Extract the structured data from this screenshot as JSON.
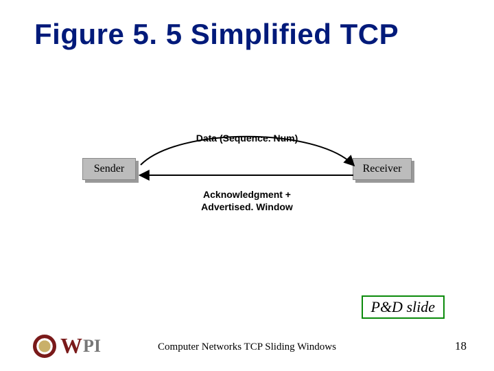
{
  "title": "Figure 5. 5 Simplified TCP",
  "diagram": {
    "sender_label": "Sender",
    "receiver_label": "Receiver",
    "top_arrow_label": "Data (Sequence. Num)",
    "bottom_arrow_label_line1": "Acknowledgment +",
    "bottom_arrow_label_line2": "Advertised. Window"
  },
  "pd_box": "P&D slide",
  "footer_text": "Computer Networks  TCP Sliding Windows",
  "page_number": "18",
  "logo_text": "WPI",
  "colors": {
    "title": "#001a7a",
    "pd_border": "#0a8a0a",
    "wpi_red": "#7a1a1a"
  }
}
